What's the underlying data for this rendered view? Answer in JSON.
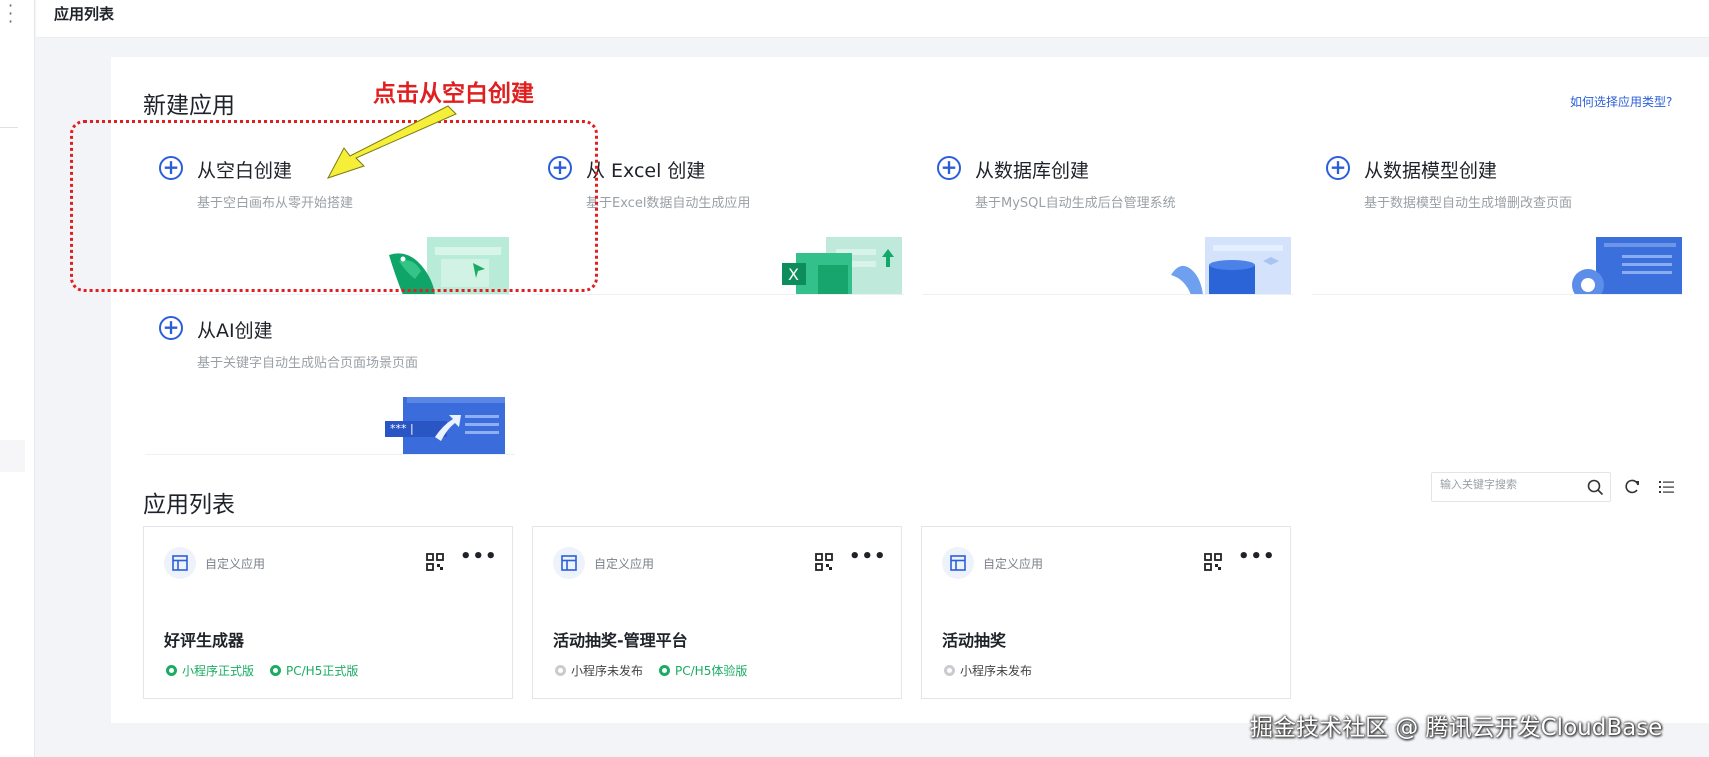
{
  "header": {
    "title": "应用列表"
  },
  "new_app": {
    "title": "新建应用",
    "help_link": "如何选择应用类型?",
    "options": [
      {
        "title": "从空白创建",
        "desc": "基于空白画布从零开始搭建"
      },
      {
        "title": "从 Excel 创建",
        "desc": "基于Excel数据自动生成应用"
      },
      {
        "title": "从数据库创建",
        "desc": "基于MySQL自动生成后台管理系统"
      },
      {
        "title": "从数据模型创建",
        "desc": "基于数据模型自动生成增删改查页面"
      },
      {
        "title": "从AI创建",
        "desc": "基于关键字自动生成贴合页面场景页面"
      }
    ],
    "ai_illustration_text": "*** |"
  },
  "annotation": {
    "text": "点击从空白创建"
  },
  "app_list": {
    "title": "应用列表",
    "search_placeholder": "输入关键字搜索",
    "apps": [
      {
        "type": "自定义应用",
        "name": "好评生成器",
        "tags": [
          {
            "label": "小程序正式版",
            "status": "on"
          },
          {
            "label": "PC/H5正式版",
            "status": "on"
          }
        ]
      },
      {
        "type": "自定义应用",
        "name": "活动抽奖-管理平台",
        "tags": [
          {
            "label": "小程序未发布",
            "status": "off"
          },
          {
            "label": "PC/H5体验版",
            "status": "on"
          }
        ]
      },
      {
        "type": "自定义应用",
        "name": "活动抽奖",
        "tags": [
          {
            "label": "小程序未发布",
            "status": "off"
          }
        ]
      }
    ]
  },
  "watermark": "掘金技术社区 @ 腾讯云开发CloudBase",
  "colors": {
    "accent": "#2b5fd9",
    "success": "#1aac62",
    "annotation": "#e02020"
  }
}
